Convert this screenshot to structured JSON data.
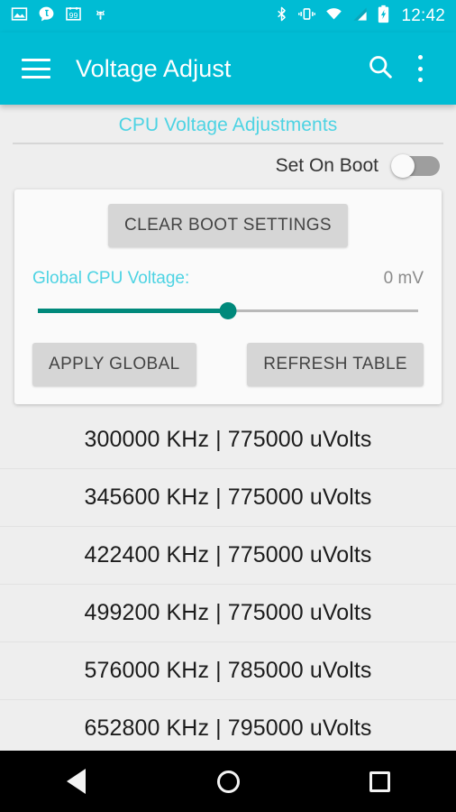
{
  "status_bar": {
    "background": "#00bcd4",
    "clock": "12:42",
    "left_icons": [
      {
        "name": "photo-icon",
        "label": "photo"
      },
      {
        "name": "tapatalk-icon",
        "label": "t"
      },
      {
        "name": "calendar-99-icon",
        "label": "99"
      },
      {
        "name": "android-head-icon",
        "label": "android"
      }
    ],
    "right_icons": [
      {
        "name": "bluetooth-icon",
        "label": "bluetooth"
      },
      {
        "name": "vibrate-icon",
        "label": "vibrate"
      },
      {
        "name": "wifi-icon",
        "label": "wifi"
      },
      {
        "name": "cellular-signal-icon",
        "label": "signal"
      },
      {
        "name": "battery-charging-icon",
        "label": "battery charging"
      }
    ]
  },
  "app_bar": {
    "background": "#00bcd4",
    "menu_icon": "hamburger-menu-icon",
    "title": "Voltage Adjust",
    "search_icon": "search-icon",
    "overflow_icon": "overflow-menu-icon"
  },
  "section": {
    "header": "CPU Voltage Adjustments",
    "header_color": "#4dd3e3"
  },
  "set_on_boot": {
    "label": "Set On Boot",
    "state": "off"
  },
  "card": {
    "clear_boot_label": "CLEAR BOOT SETTINGS",
    "global_voltage_label": "Global CPU Voltage:",
    "global_voltage_value": "0 mV",
    "slider": {
      "percent": 50,
      "accent": "#00897b"
    },
    "apply_global_label": "APPLY GLOBAL",
    "refresh_table_label": "REFRESH TABLE"
  },
  "freq_table": {
    "rows": [
      {
        "text": "300000 KHz | 775000 uVolts"
      },
      {
        "text": "345600 KHz | 775000 uVolts"
      },
      {
        "text": "422400 KHz | 775000 uVolts"
      },
      {
        "text": "499200 KHz | 775000 uVolts"
      },
      {
        "text": "576000 KHz | 785000 uVolts"
      },
      {
        "text": "652800 KHz | 795000 uVolts"
      }
    ]
  },
  "nav_bar": {
    "back": "back-button",
    "home": "home-button",
    "recents": "recents-button"
  }
}
